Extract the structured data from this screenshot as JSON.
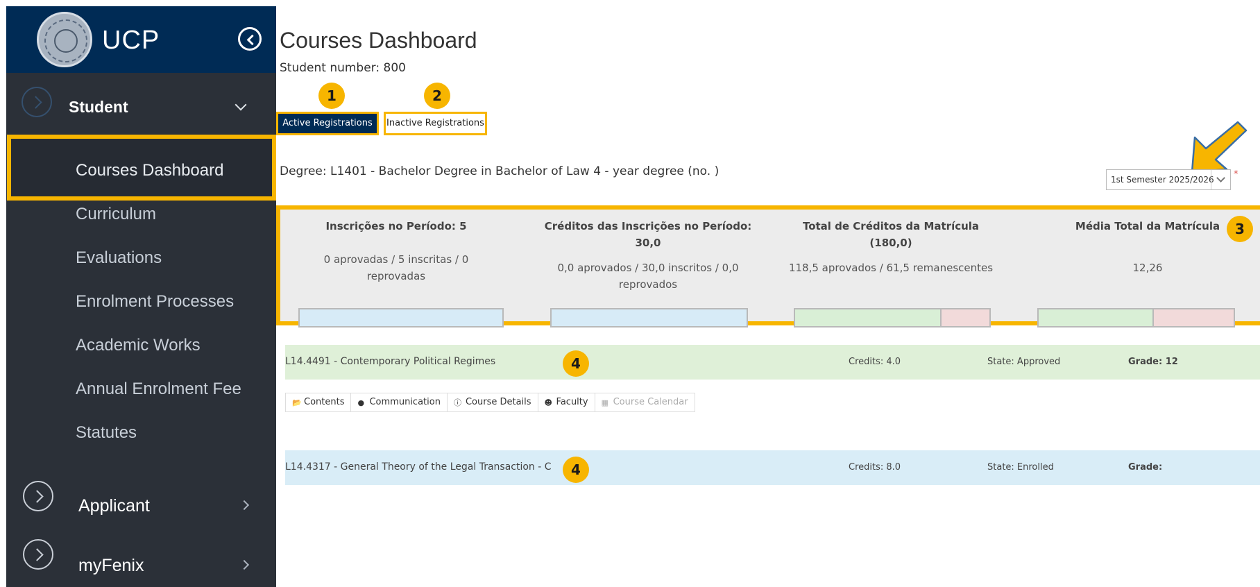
{
  "sidebar": {
    "brand": "UCP",
    "sections": [
      {
        "label": "Student",
        "expanded": true
      },
      {
        "label": "Applicant",
        "expanded": false
      },
      {
        "label": "myFenix",
        "expanded": false
      }
    ],
    "student_items": [
      {
        "label": "Courses Dashboard",
        "active": true
      },
      {
        "label": "Curriculum"
      },
      {
        "label": "Evaluations"
      },
      {
        "label": "Enrolment Processes"
      },
      {
        "label": "Academic Works"
      },
      {
        "label": "Annual Enrolment Fee"
      },
      {
        "label": "Statutes"
      }
    ]
  },
  "main": {
    "title": "Courses Dashboard",
    "student_number": "Student number: 800",
    "tabs": [
      {
        "label": "Active Registrations",
        "active": true
      },
      {
        "label": "Inactive Registrations",
        "active": false
      }
    ],
    "degree": "Degree: L1401 - Bachelor Degree in Bachelor of Law 4 - year degree (no.                      )",
    "semester_select": {
      "value": "1st Semester 2025/2026",
      "required_mark": "*"
    },
    "badges": [
      "1",
      "2",
      "3",
      "4",
      "4"
    ],
    "stats": [
      {
        "title": "Inscrições no Período: 5",
        "subtitle": "0 aprovadas / 5 inscritas / 0 reprovadas",
        "approved_fraction": 0
      },
      {
        "title": "Créditos das Inscrições no Período: 30,0",
        "subtitle": "0,0 aprovados / 30,0 inscritos / 0,0 reprovados",
        "approved_fraction": 0
      },
      {
        "title": "Total de Créditos da Matrícula (180,0)",
        "subtitle": "118,5 aprovados / 61,5 remanescentes",
        "approved_fraction": 0.6583
      },
      {
        "title": "Média Total da Matrícula",
        "subtitle": "12,26",
        "approved_fraction": 0.613
      }
    ],
    "courses": [
      {
        "name": "L14.4491 - Contemporary Political Regimes",
        "credits": "Credits: 4.0",
        "state": "State: Approved",
        "grade": "Grade: 12"
      },
      {
        "name": "L14.4317 - General Theory of the Legal Transaction - C",
        "credits": "Credits: 8.0",
        "state": "State: Enrolled",
        "grade": "Grade:"
      }
    ],
    "course_actions": [
      {
        "label": "Contents",
        "icon": "folder-open-icon",
        "enabled": true
      },
      {
        "label": "Communication",
        "icon": "comment-icon",
        "enabled": true
      },
      {
        "label": "Course Details",
        "icon": "info-icon",
        "enabled": true
      },
      {
        "label": "Faculty",
        "icon": "users-icon",
        "enabled": true
      },
      {
        "label": "Course Calendar",
        "icon": "calendar-icon",
        "enabled": false
      }
    ]
  },
  "colors": {
    "sidebar_bg": "#2b3038",
    "header_bg": "#002b55",
    "highlight": "#f7b500",
    "approved_row": "#dff0d8",
    "enrolled_row": "#d9edf7"
  }
}
